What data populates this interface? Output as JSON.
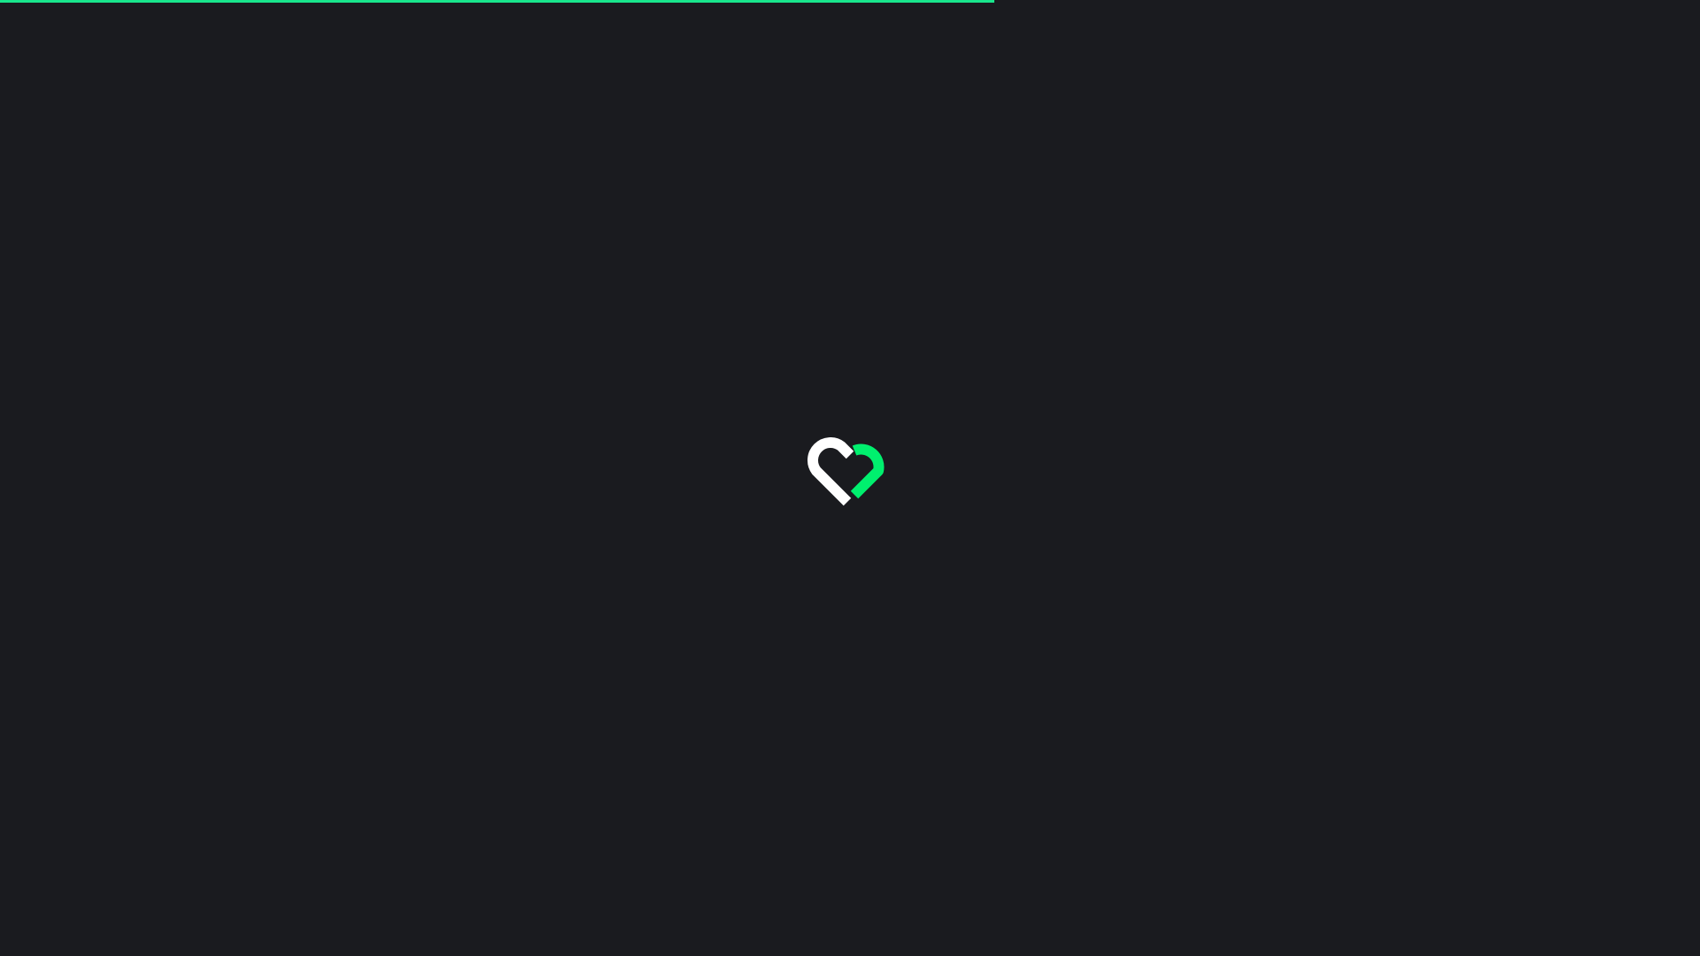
{
  "loading": {
    "progress_fraction": 0.585
  },
  "colors": {
    "background": "#1a1b1f",
    "accent": "#19e68c",
    "logo_primary": "#ffffff",
    "logo_accent": "#00f06e"
  },
  "icons": {
    "logo": "heart-logo-icon"
  }
}
